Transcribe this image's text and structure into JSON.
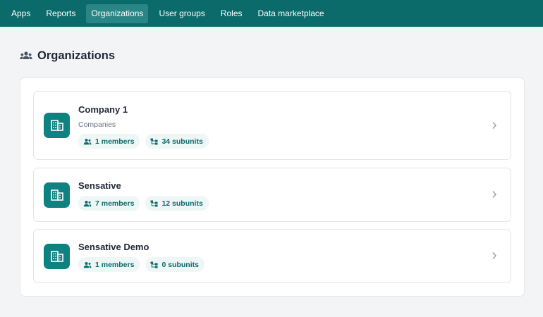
{
  "nav": {
    "items": [
      {
        "label": "Apps",
        "active": false
      },
      {
        "label": "Reports",
        "active": false
      },
      {
        "label": "Organizations",
        "active": true
      },
      {
        "label": "User groups",
        "active": false
      },
      {
        "label": "Roles",
        "active": false
      },
      {
        "label": "Data marketplace",
        "active": false
      }
    ]
  },
  "header": {
    "icon": "people-group-icon",
    "title": "Organizations"
  },
  "organizations": [
    {
      "name": "Company 1",
      "type": "Companies",
      "members": "1 members",
      "subunits": "34 subunits"
    },
    {
      "name": "Sensative",
      "type": "",
      "members": "7 members",
      "subunits": "12 subunits"
    },
    {
      "name": "Sensative Demo",
      "type": "",
      "members": "1 members",
      "subunits": "0 subunits"
    }
  ],
  "colors": {
    "nav_bg": "#0b6b6b",
    "nav_active": "#2a8585",
    "accent": "#0d8281",
    "badge_bg": "#eef6f6",
    "badge_text": "#0b6b6b",
    "page_bg": "#f3f4f6"
  }
}
